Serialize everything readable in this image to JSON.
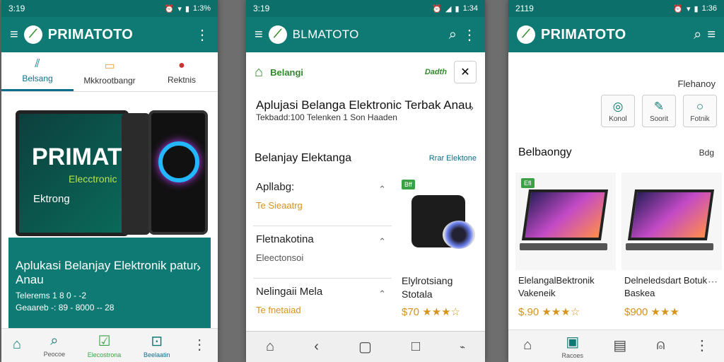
{
  "colors": {
    "teal": "#0f7a73",
    "accent_orange": "#d8931c",
    "badge_green": "#3aa245"
  },
  "phone1": {
    "status": {
      "time": "3:19",
      "right": "1:3%"
    },
    "appbar": {
      "title": "PRIMATOTO"
    },
    "tabs": [
      {
        "label": "Belsang"
      },
      {
        "label": "Mkkrootbangr"
      },
      {
        "label": "Rektnis"
      }
    ],
    "hero": {
      "brand": "PRIMAT",
      "sub": "Elecctronic",
      "brand2": "Ektrong"
    },
    "banner": {
      "title": "Aplukasi Belanjay Elektronik patur Anau",
      "line1": "Telerems 1 8 0 - -2",
      "line2": "Geaareb -: 89 - 8000 -- 28"
    },
    "nav": [
      {
        "label": ""
      },
      {
        "label": "Peocoe"
      },
      {
        "label": "Elecostrona"
      },
      {
        "label": "Beelaatin"
      },
      {
        "label": ""
      }
    ]
  },
  "phone2": {
    "status": {
      "time": "3:19",
      "right": "1:34"
    },
    "appbar": {
      "title": "BLMATOTO"
    },
    "brandrow": {
      "left": "Belangi",
      "right": "Dadth"
    },
    "intro": {
      "title": "Aplujasi Belanga Elektronic Terbak Anau",
      "sub": "Tekbadd:100 Telenken 1 Son Haaden"
    },
    "section": {
      "title": "Belanjay Elektanga",
      "link": "Rrar Elektone"
    },
    "list": [
      {
        "title": "Apllabg:",
        "sub": "Te Sieaatrg"
      },
      {
        "title": "Fletnakotina",
        "sub": "Eleectonsoi"
      },
      {
        "title": "Nelingaii Mela",
        "sub": "Te fnetaiad"
      }
    ],
    "product": {
      "badge": "Bff",
      "title": "Elylrotsiang Stotala",
      "price": "$70 ★★★☆"
    }
  },
  "phone3": {
    "status": {
      "time": "2119",
      "right": "1:36"
    },
    "appbar": {
      "title": "PRIMATOTO"
    },
    "top": {
      "label": "Flehanoy"
    },
    "chips": [
      {
        "label": "Konol"
      },
      {
        "label": "Soorit"
      },
      {
        "label": "Fotnik"
      }
    ],
    "section": {
      "title": "Belbaongy",
      "link": "Bdg"
    },
    "cards": [
      {
        "badge": "Efl",
        "title": "ElelangalBektronik Vakeneik",
        "price": "$.90 ★★★☆"
      },
      {
        "badge": "",
        "title": "Delneledsdart Botuk Baskea",
        "price": "$900 ★★★"
      }
    ],
    "nav": [
      {
        "label": ""
      },
      {
        "label": "Racoes"
      },
      {
        "label": ""
      },
      {
        "label": ""
      },
      {
        "label": ""
      }
    ]
  }
}
